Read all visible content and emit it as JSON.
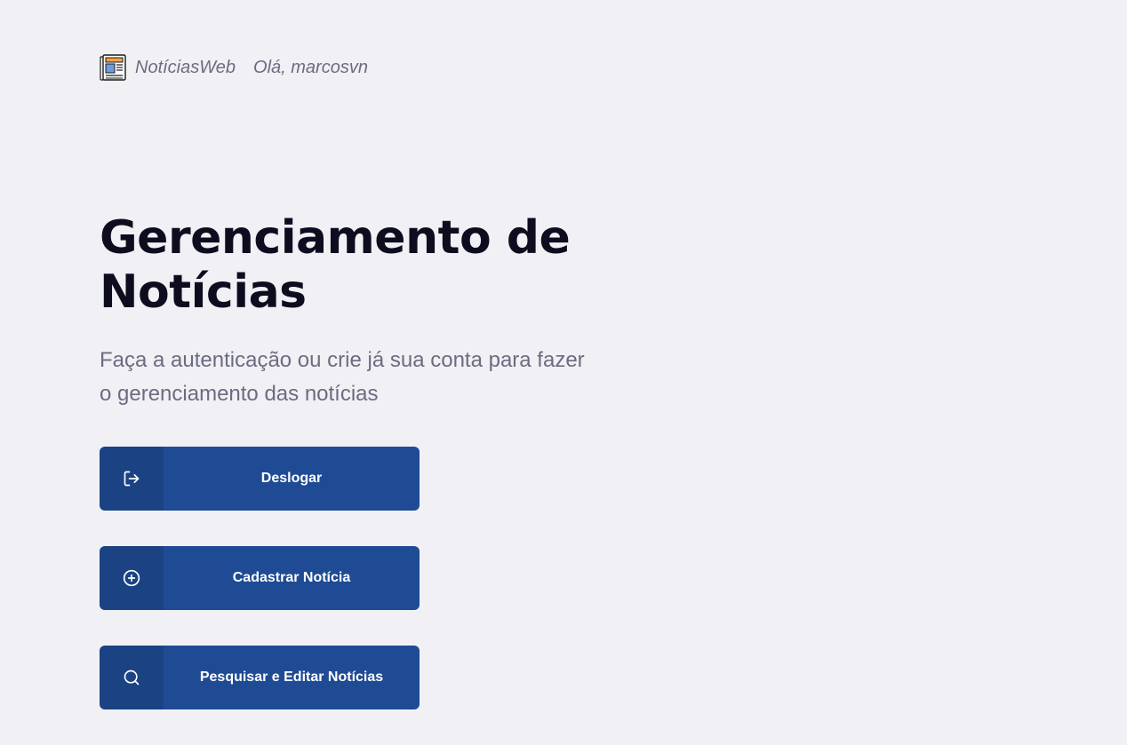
{
  "header": {
    "brand": "NotíciasWeb",
    "greeting": "Olá, marcosvn",
    "logo_icon": "newspaper-icon"
  },
  "main": {
    "title": "Gerenciamento de Notícias",
    "subtitle": "Faça a autenticação ou crie já sua conta para fazer o gerenciamento das notícias"
  },
  "buttons": [
    {
      "label": "Deslogar",
      "icon": "logout-icon"
    },
    {
      "label": "Cadastrar Notícia",
      "icon": "plus-circle-icon"
    },
    {
      "label": "Pesquisar e Editar Notícias",
      "icon": "search-icon"
    }
  ],
  "colors": {
    "background": "#f0f0f5",
    "button": "#1f4b94",
    "title": "#0d0d1f",
    "muted_text": "#6c6c80"
  }
}
